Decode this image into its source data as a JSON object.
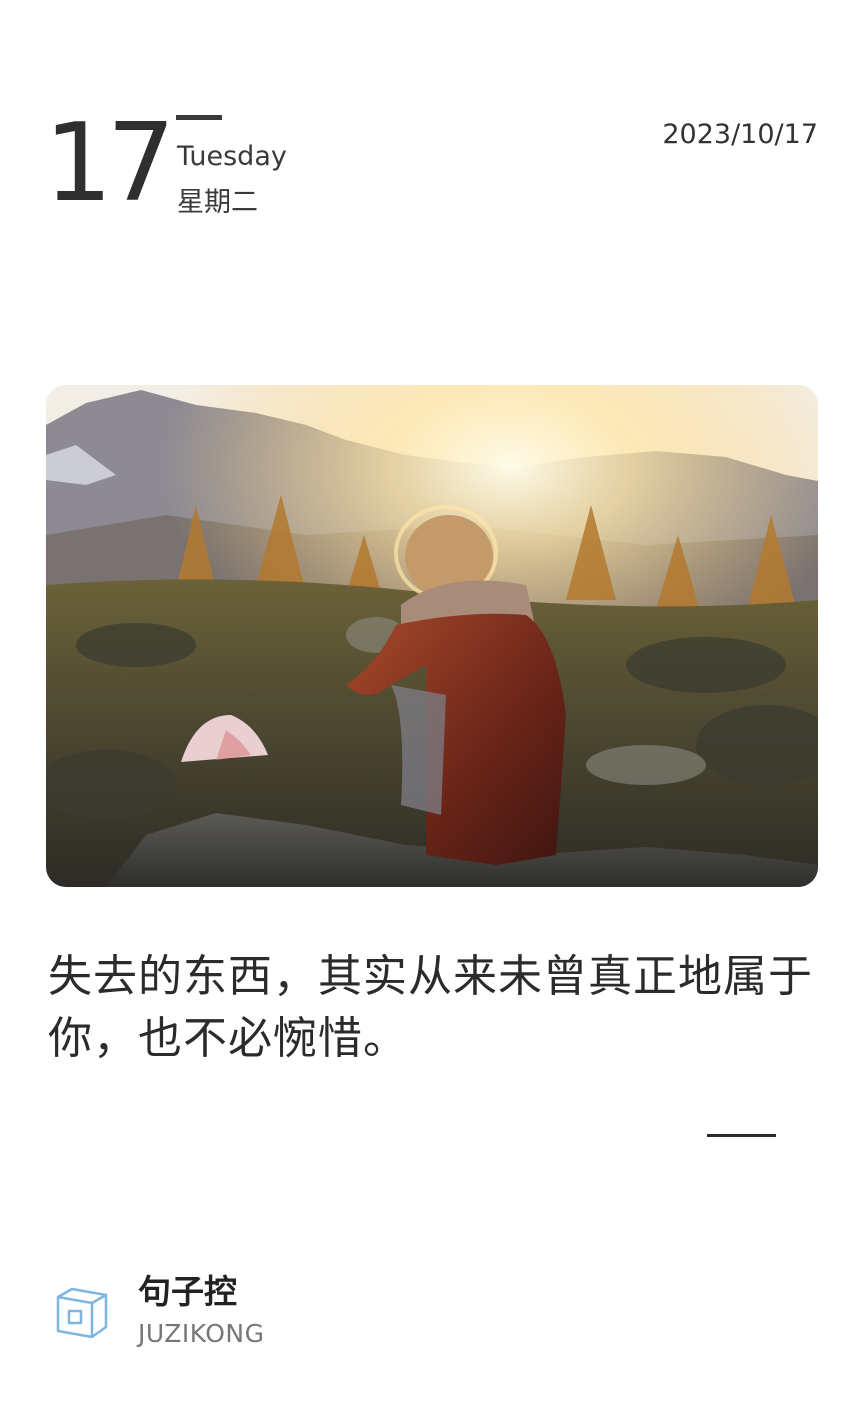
{
  "header": {
    "day": "17",
    "weekday_en": "Tuesday",
    "weekday_cn": "星期二",
    "date": "2023/10/17"
  },
  "photo": {
    "icon": "photo-person-sunset-mountains"
  },
  "quote": {
    "text": "失去的东西，其实从来未曾真正地属于你，也不必惋惜。"
  },
  "brand": {
    "logo_icon": "juzikong-logo-icon",
    "name_cn": "句子控",
    "name_en": "JUZIKONG",
    "logo_color": "#7fb6e0"
  }
}
